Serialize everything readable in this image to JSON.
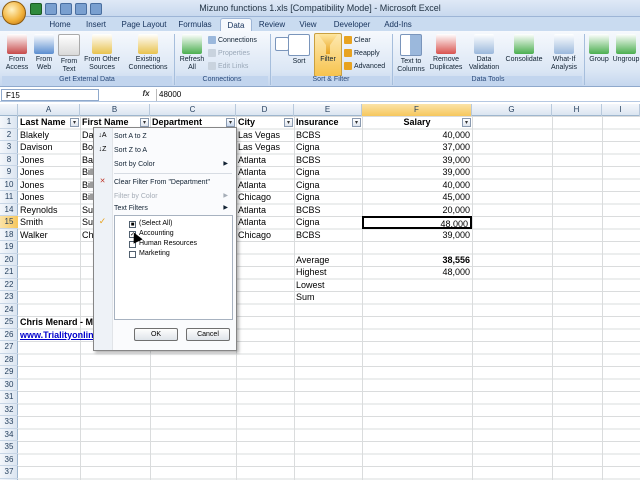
{
  "window": {
    "title": "Mizuno functions 1.xls  [Compatibility Mode] - Microsoft Excel"
  },
  "ribbon_tabs": [
    "Home",
    "Insert",
    "Page Layout",
    "Formulas",
    "Data",
    "Review",
    "View",
    "Developer",
    "Add-Ins"
  ],
  "active_tab": "Data",
  "ribbon": {
    "get_external": {
      "from_access": "From Access",
      "from_web": "From Web",
      "from_text": "From Text",
      "from_other": "From Other Sources",
      "existing": "Existing Connections",
      "label": "Get External Data"
    },
    "connections": {
      "refresh": "Refresh All",
      "connections": "Connections",
      "properties": "Properties",
      "edit_links": "Edit Links",
      "label": "Connections"
    },
    "sort_filter": {
      "sort": "Sort",
      "filter": "Filter",
      "clear": "Clear",
      "reapply": "Reapply",
      "advanced": "Advanced",
      "label": "Sort & Filter"
    },
    "data_tools": {
      "text_to_columns": "Text to Columns",
      "remove_duplicates": "Remove Duplicates",
      "data_validation": "Data Validation",
      "consolidate": "Consolidate",
      "what_if": "What-If Analysis",
      "label": "Data Tools"
    },
    "outline": {
      "group": "Group",
      "ungroup": "Ungroup"
    }
  },
  "formula_bar": {
    "name_box": "F15",
    "fx": "fx",
    "content": "48000"
  },
  "columns": [
    "A",
    "B",
    "C",
    "D",
    "E",
    "F",
    "G",
    "H",
    "I"
  ],
  "selected_column": "F",
  "rows": [
    "1",
    "2",
    "3",
    "8",
    "9",
    "10",
    "11",
    "14",
    "15",
    "18",
    "19",
    "20",
    "21",
    "22",
    "23",
    "24",
    "25",
    "26",
    "27",
    "28",
    "29",
    "30",
    "31",
    "32",
    "33",
    "34",
    "35",
    "36",
    "37"
  ],
  "selected_row": "15",
  "headers": {
    "last_name": "Last Name",
    "first_name": "First Name",
    "department": "Department",
    "city": "City",
    "insurance": "Insurance",
    "salary": "Salary"
  },
  "data_rows": [
    {
      "last": "Blakely",
      "first": "Da",
      "city": "Las Vegas",
      "ins": "BCBS",
      "salary": "40,000"
    },
    {
      "last": "Davison",
      "first": "Bo",
      "city": "Las Vegas",
      "ins": "Cigna",
      "salary": "37,000"
    },
    {
      "last": "Jones",
      "first": "Ba",
      "city": "Atlanta",
      "ins": "BCBS",
      "salary": "39,000"
    },
    {
      "last": "Jones",
      "first": "Bill",
      "city": "Atlanta",
      "ins": "Cigna",
      "salary": "39,000"
    },
    {
      "last": "Jones",
      "first": "Bill",
      "city": "Atlanta",
      "ins": "Cigna",
      "salary": "40,000"
    },
    {
      "last": "Jones",
      "first": "Bill",
      "city": "Chicago",
      "ins": "Cigna",
      "salary": "45,000"
    },
    {
      "last": "Reynolds",
      "first": "Su",
      "city": "Atlanta",
      "ins": "BCBS",
      "salary": "20,000"
    },
    {
      "last": "Smith",
      "first": "Su",
      "city": "Atlanta",
      "ins": "Cigna",
      "salary": "48,000"
    },
    {
      "last": "Walker",
      "first": "Ch",
      "city": "Chicago",
      "ins": "BCBS",
      "salary": "39,000"
    }
  ],
  "summary": {
    "average_label": "Average",
    "average_value": "38,556",
    "highest_label": "Highest",
    "highest_value": "48,000",
    "lowest_label": "Lowest",
    "sum_label": "Sum"
  },
  "footer": {
    "author": "Chris Menard - M",
    "link": "www.Trialityonlin"
  },
  "filter_menu": {
    "sort_az": "Sort A to Z",
    "sort_za": "Sort Z to A",
    "sort_color": "Sort by Color",
    "clear_filter": "Clear Filter From \"Department\"",
    "filter_color": "Filter by Color",
    "text_filters": "Text Filters",
    "items": [
      {
        "label": "(Select All)",
        "state": "partial"
      },
      {
        "label": "Accounting",
        "state": "checked"
      },
      {
        "label": "Human Resources",
        "state": "unchecked"
      },
      {
        "label": "Marketing",
        "state": "unchecked"
      }
    ],
    "ok": "OK",
    "cancel": "Cancel"
  }
}
